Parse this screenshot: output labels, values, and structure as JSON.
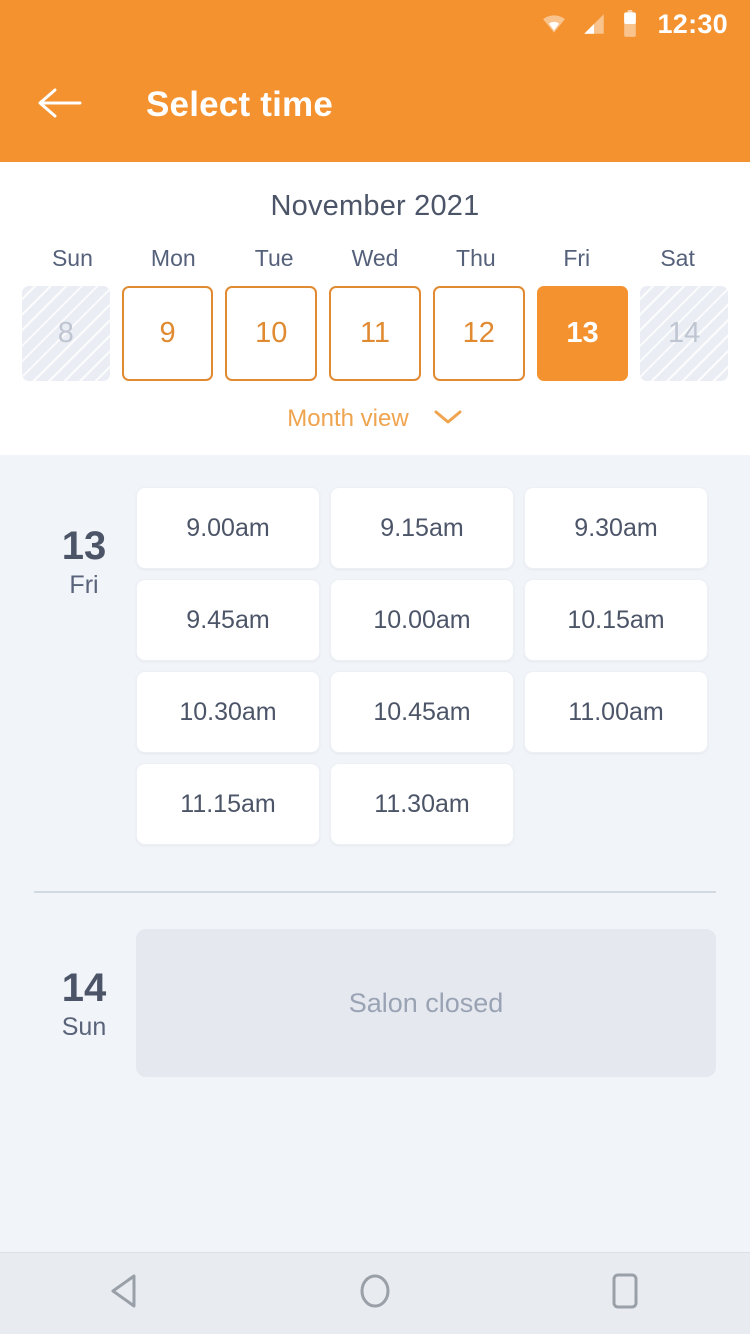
{
  "status_bar": {
    "time": "12:30",
    "icons": [
      "wifi-icon",
      "signal-icon",
      "battery-icon"
    ]
  },
  "app_bar": {
    "back_icon": "back-arrow-icon",
    "title": "Select time"
  },
  "calendar": {
    "month_label": "November 2021",
    "weekdays": [
      "Sun",
      "Mon",
      "Tue",
      "Wed",
      "Thu",
      "Fri",
      "Sat"
    ],
    "days": [
      {
        "number": "8",
        "state": "disabled"
      },
      {
        "number": "9",
        "state": "available"
      },
      {
        "number": "10",
        "state": "available"
      },
      {
        "number": "11",
        "state": "available"
      },
      {
        "number": "12",
        "state": "available"
      },
      {
        "number": "13",
        "state": "selected"
      },
      {
        "number": "14",
        "state": "disabled"
      }
    ],
    "month_view_label": "Month view",
    "month_view_icon": "chevron-down-icon"
  },
  "schedule": [
    {
      "date_number": "13",
      "day_of_week": "Fri",
      "slots": [
        "9.00am",
        "9.15am",
        "9.30am",
        "9.45am",
        "10.00am",
        "10.15am",
        "10.30am",
        "10.45am",
        "11.00am",
        "11.15am",
        "11.30am"
      ],
      "closed_label": ""
    },
    {
      "date_number": "14",
      "day_of_week": "Sun",
      "slots": [],
      "closed_label": "Salon closed"
    }
  ],
  "nav_bar": {
    "back_icon": "nav-back-triangle-icon",
    "home_icon": "nav-home-circle-icon",
    "recents_icon": "nav-recents-square-icon"
  },
  "colors": {
    "accent": "#F3922F",
    "accent_border": "#E08A32",
    "accent_muted": "#EFA44F",
    "text_dark": "#4C5568",
    "text_muted": "#9AA3B4",
    "body_bg": "#F1F4F8",
    "card_bg": "#FFFFFF",
    "closed_bg": "#E5E9EF"
  }
}
